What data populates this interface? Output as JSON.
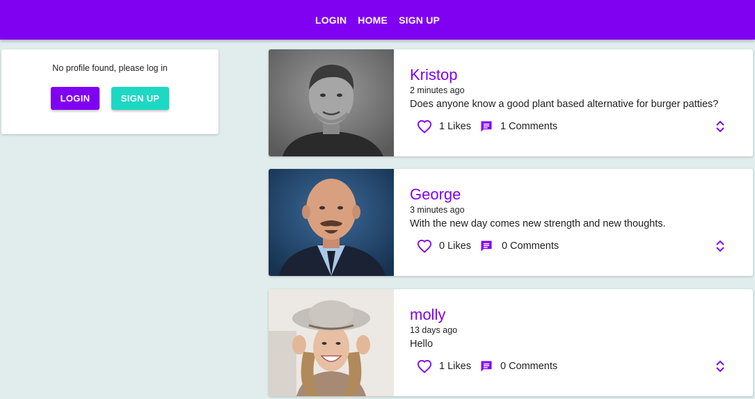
{
  "nav": {
    "login": "LOGIN",
    "home": "HOME",
    "signup": "SIGN UP"
  },
  "profile": {
    "message": "No profile found, please log in",
    "login_button": "LOGIN",
    "signup_button": "SIGN UP"
  },
  "posts": [
    {
      "handle": "Kristop",
      "time": "2 minutes ago",
      "body": "Does anyone know a good plant based alternative for burger patties?",
      "likes": "1 Likes",
      "comments": "1 Comments"
    },
    {
      "handle": "George",
      "time": "3 minutes ago",
      "body": "With the new day comes new strength and new thoughts.",
      "likes": "0 Likes",
      "comments": "0 Comments"
    },
    {
      "handle": "molly",
      "time": "13 days ago",
      "body": "Hello",
      "likes": "1 Likes",
      "comments": "0 Comments"
    }
  ],
  "icons": {
    "like": "heart-icon",
    "comment": "chat-icon",
    "expand": "unfold-more-icon"
  },
  "colors": {
    "primary": "#8000f2",
    "secondary": "#1dd8c3",
    "background": "#e0edec"
  }
}
